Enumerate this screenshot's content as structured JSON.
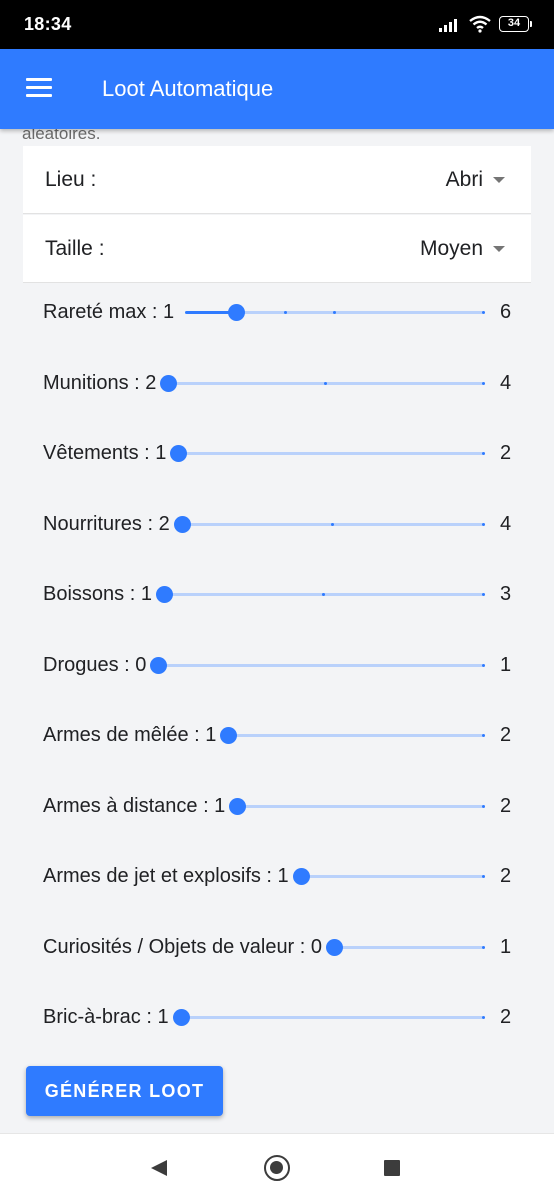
{
  "status_bar": {
    "time": "18:34",
    "battery": "34"
  },
  "app_bar": {
    "title": "Loot Automatique"
  },
  "partial_text": "aléatoires.",
  "lieu": {
    "label": "Lieu :",
    "value": "Abri"
  },
  "taille": {
    "label": "Taille :",
    "value": "Moyen"
  },
  "sliders": [
    {
      "label": "Rareté max : 1",
      "value": 1,
      "min": 0,
      "max": 6,
      "max_label": "6",
      "ticks": [
        0,
        1,
        2,
        3
      ]
    },
    {
      "label": "Munitions : 2",
      "value": 2,
      "min": 2,
      "max": 4,
      "max_label": "4",
      "ticks": [
        3
      ]
    },
    {
      "label": "Vêtements : 1",
      "value": 1,
      "min": 1,
      "max": 2,
      "max_label": "2",
      "ticks": []
    },
    {
      "label": "Nourritures : 2",
      "value": 2,
      "min": 2,
      "max": 4,
      "max_label": "4",
      "ticks": [
        3
      ]
    },
    {
      "label": "Boissons : 1",
      "value": 1,
      "min": 1,
      "max": 3,
      "max_label": "3",
      "ticks": [
        2
      ]
    },
    {
      "label": "Drogues : 0",
      "value": 0,
      "min": 0,
      "max": 1,
      "max_label": "1",
      "ticks": []
    },
    {
      "label": "Armes de mêlée : 1",
      "value": 1,
      "min": 1,
      "max": 2,
      "max_label": "2",
      "ticks": []
    },
    {
      "label": "Armes à distance : 1",
      "value": 1,
      "min": 1,
      "max": 2,
      "max_label": "2",
      "ticks": []
    },
    {
      "label": "Armes de jet et explosifs : 1",
      "value": 1,
      "min": 1,
      "max": 2,
      "max_label": "2",
      "ticks": []
    },
    {
      "label": "Curiosités / Objets de valeur : 0",
      "value": 0,
      "min": 0,
      "max": 1,
      "max_label": "1",
      "ticks": []
    },
    {
      "label": "Bric-à-brac : 1",
      "value": 1,
      "min": 1,
      "max": 2,
      "max_label": "2",
      "ticks": []
    }
  ],
  "generate_button": {
    "label": "GÉNÉRER LOOT"
  },
  "colors": {
    "primary": "#2f7bff",
    "track_inactive": "#b9d1fb",
    "background": "#f3f4f6"
  },
  "icons": {
    "menu": "menu-icon",
    "dropdown": "dropdown-arrow-icon",
    "nav_back": "back-icon",
    "nav_home": "home-icon",
    "nav_recent": "recent-apps-icon"
  }
}
